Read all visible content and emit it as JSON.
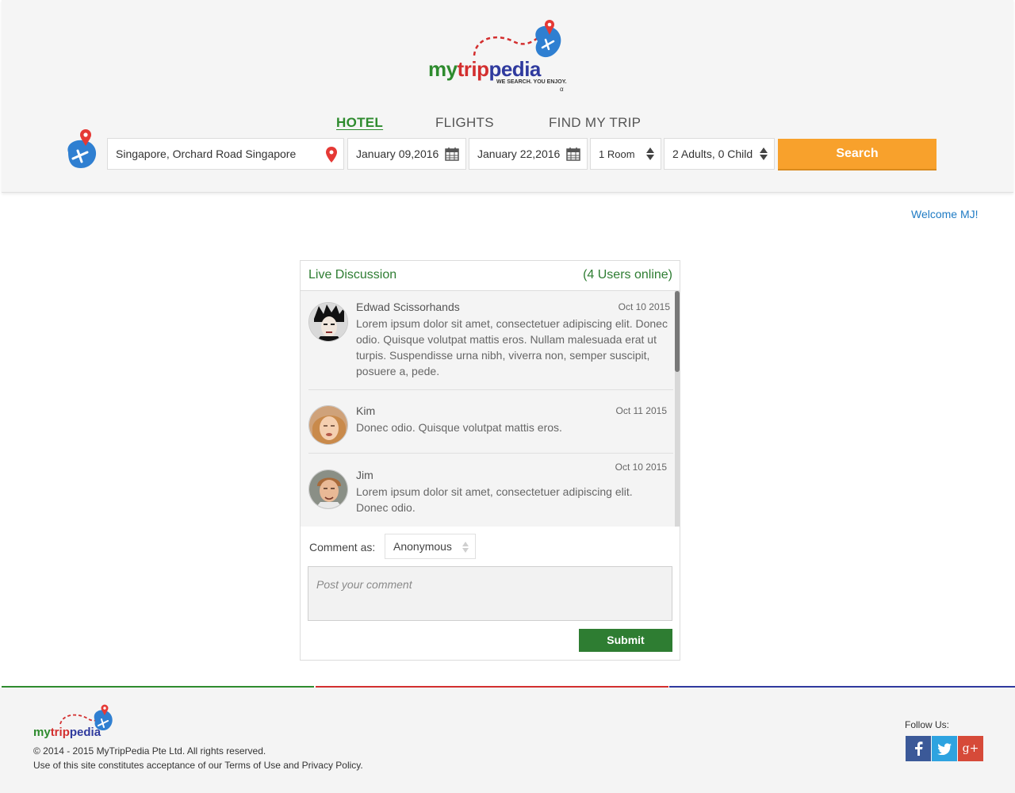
{
  "brand": {
    "name_parts": [
      "my",
      "trip",
      "pedia"
    ],
    "tagline": "WE SEARCH. YOU ENJOY.",
    "badge": "α"
  },
  "tabs": [
    {
      "label": "HOTEL",
      "active": true
    },
    {
      "label": "FLIGHTS",
      "active": false
    },
    {
      "label": "FIND MY TRIP",
      "active": false
    }
  ],
  "search": {
    "location": "Singapore, Orchard Road Singapore",
    "check_in": "January 09,2016",
    "check_out": "January 22,2016",
    "rooms": "1 Room",
    "guests": "2 Adults, 0 Child",
    "button": "Search"
  },
  "welcome": "Welcome MJ!",
  "discussion": {
    "title": "Live Discussion",
    "online": "(4 Users online)",
    "messages": [
      {
        "name": "Edwad Scissorhands",
        "date": "Oct 10 2015",
        "text": "Lorem ipsum dolor sit amet, consectetuer adipiscing elit. Donec odio. Quisque volutpat mattis eros. Nullam malesuada erat ut turpis. Suspendisse urna nibh, viverra non, semper suscipit, posuere a, pede."
      },
      {
        "name": "Kim",
        "date": "Oct 11 2015",
        "text": "Donec odio. Quisque volutpat mattis eros."
      },
      {
        "name": "Jim",
        "date": "Oct 10 2015",
        "text": "Lorem ipsum dolor sit amet, consectetuer adipiscing elit. Donec odio."
      }
    ],
    "comment_as_label": "Comment as:",
    "comment_as_value": "Anonymous",
    "comment_placeholder": "Post your comment",
    "submit": "Submit"
  },
  "footer": {
    "copyright": "© 2014 - 2015 MyTripPedia Pte Ltd. All rights reserved.",
    "terms": "Use of this site constitutes acceptance of our Terms of Use and Privacy Policy.",
    "follow": "Follow Us:",
    "social": [
      {
        "icon": "facebook-icon",
        "glyph": "f",
        "color": "#3b5998"
      },
      {
        "icon": "twitter-icon",
        "glyph": "t",
        "color": "#2ea3e0"
      },
      {
        "icon": "google-plus-icon",
        "glyph": "g+",
        "color": "#d64a39"
      }
    ]
  },
  "colors": {
    "green": "#2e7d32",
    "orange": "#f8a12c",
    "red": "#d32f2f",
    "blue": "#2f3a9e",
    "link": "#1f7bc4"
  }
}
